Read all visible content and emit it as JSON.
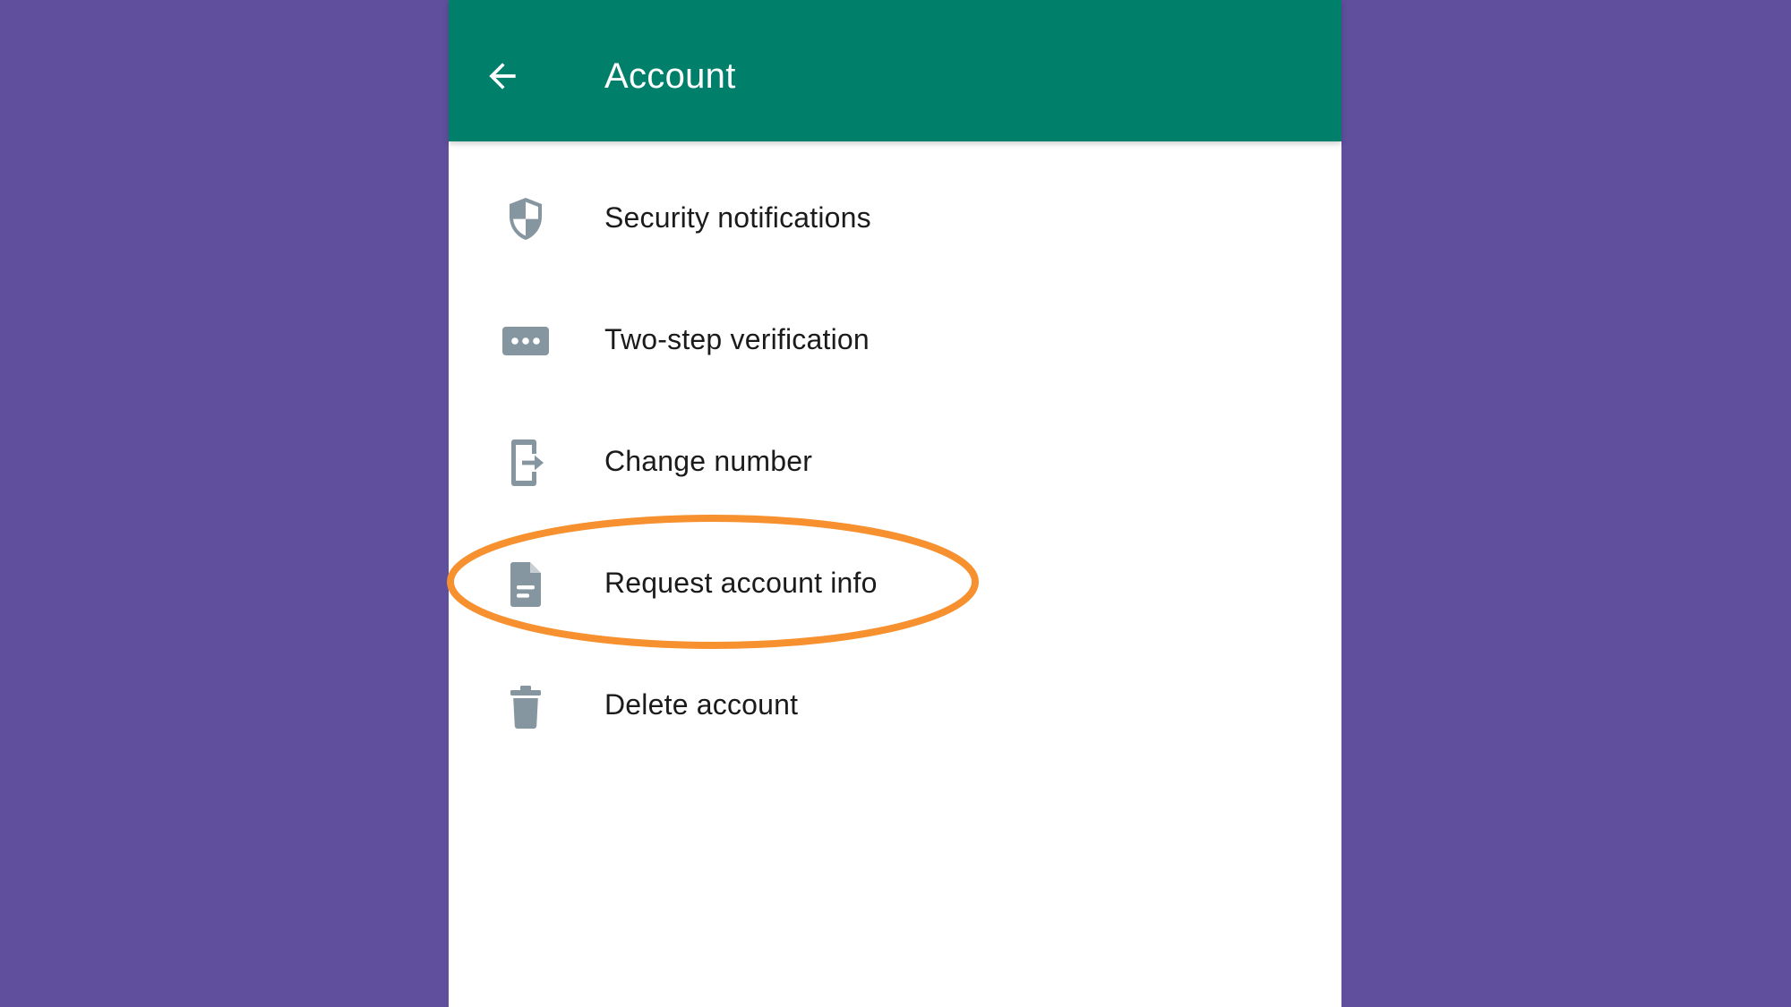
{
  "header": {
    "title": "Account",
    "back_icon": "arrow-left-icon",
    "background_color": "#00806a"
  },
  "menu": {
    "items": [
      {
        "label": "Security notifications",
        "icon": "shield-icon"
      },
      {
        "label": "Two-step verification",
        "icon": "password-dots-icon"
      },
      {
        "label": "Change number",
        "icon": "phone-export-icon"
      },
      {
        "label": "Request account info",
        "icon": "document-icon"
      },
      {
        "label": "Delete account",
        "icon": "trash-icon"
      }
    ]
  },
  "annotation": {
    "highlighted_item": "Request account info",
    "ring_color": "#f7902e"
  },
  "colors": {
    "page_background": "#5f4f9c",
    "icon_color": "#8696a0",
    "text_color": "#1b1b1b"
  }
}
